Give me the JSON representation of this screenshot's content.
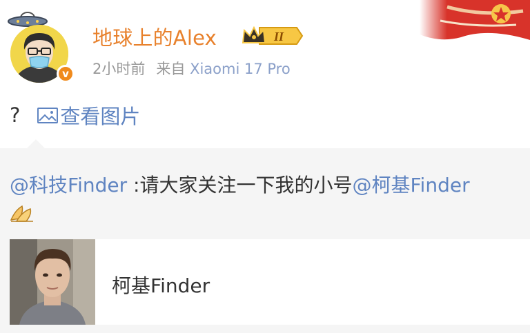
{
  "post": {
    "username": "地球上的Alex",
    "level_badge": "II",
    "time": "2小时前",
    "source_prefix": "来自",
    "device": "Xiaomi 17 Pro",
    "text": "?",
    "view_image_label": "查看图片"
  },
  "repost": {
    "author": "@科技Finder",
    "separator": " :",
    "body": "请大家关注一下我的小号",
    "mention": "@柯基Finder",
    "emoji": "pray-hands-emoji",
    "card": {
      "title": "柯基Finder"
    }
  },
  "colors": {
    "username": "#e8812c",
    "link": "#5f84c1",
    "meta": "#999999",
    "repost_bg": "#f5f5f5"
  }
}
